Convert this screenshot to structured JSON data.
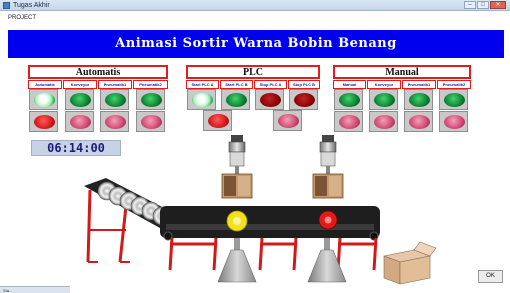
{
  "window": {
    "title": "Tugas Akhir",
    "menu_label": "PROJECT",
    "controls": [
      "minimize",
      "maximize",
      "close"
    ]
  },
  "banner": {
    "title": "Animasi Sortir Warna Bobin Benang",
    "color": "#0000ee"
  },
  "panels": {
    "automatis": {
      "title": "Automatis",
      "labels": [
        "Automatis",
        "Konveyor",
        "Pneumatik1",
        "Pneumatik2"
      ],
      "top_leds": [
        "white",
        "green",
        "green",
        "green"
      ],
      "bottom_leds": [
        "red",
        "pink",
        "pink",
        "pink"
      ]
    },
    "plc": {
      "title": "PLC",
      "labels": [
        "Start PLC A",
        "Start PLC B",
        "Stop PLC A",
        "Stop PLC B"
      ],
      "top_leds": [
        "white",
        "green",
        "darkred",
        "darkred"
      ],
      "bottom_leds": [
        "red",
        "pink"
      ]
    },
    "manual": {
      "title": "Manual",
      "labels": [
        "Manual",
        "Konveyor",
        "Pneumatik1",
        "Pneumatik2"
      ],
      "top_leds": [
        "green",
        "green",
        "green",
        "green"
      ],
      "bottom_leds": [
        "pink",
        "pink",
        "pink",
        "pink"
      ]
    }
  },
  "clock": {
    "time": "06:14:00"
  },
  "conveyor": {
    "pneumatic_cylinders": 2,
    "bobbins_on_belt": [
      {
        "color": "yellow",
        "hex": "#f2e21b"
      },
      {
        "color": "red",
        "hex": "#e01b1b"
      }
    ],
    "spools_in_feeder": 6,
    "sort_chutes": 2,
    "collection_box": "cardboard-box"
  },
  "ok_button": {
    "label": "OK"
  },
  "taskbar": {
    "items": [
      "Sta..."
    ]
  },
  "colors": {
    "panel_border": "#e01e1e",
    "led_green": "#0b7a2f",
    "led_red": "#d41919",
    "belt": "#222222",
    "frame_red": "#d41919"
  }
}
